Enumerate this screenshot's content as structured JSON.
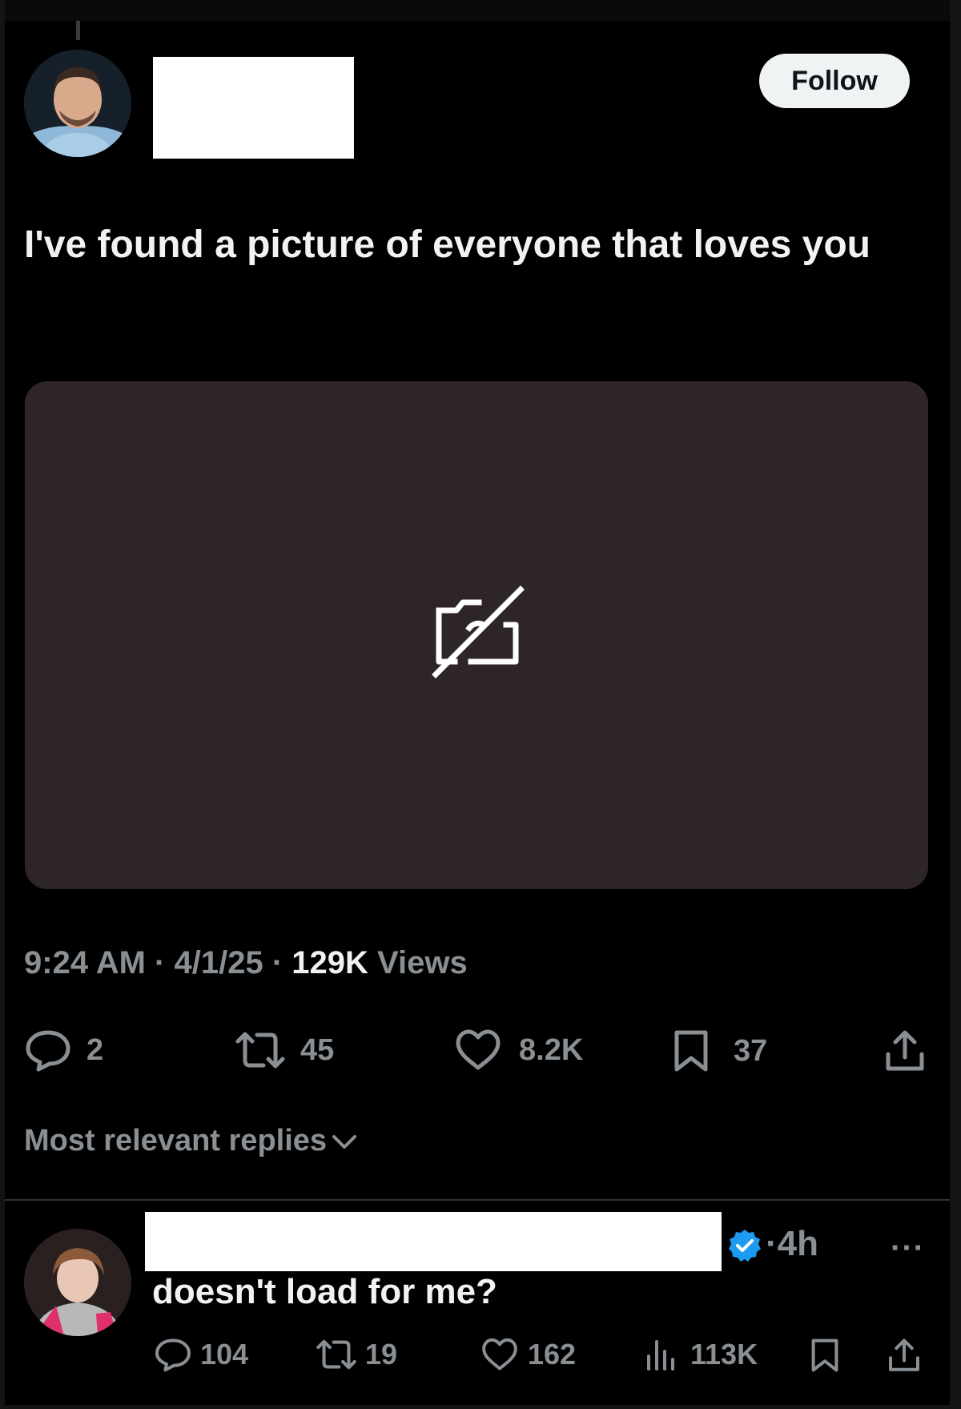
{
  "post": {
    "follow_label": "Follow",
    "text": "I've found a picture of everyone that loves you",
    "media_icon": "camera-off-icon",
    "time": "9:24 AM",
    "sep1": "·",
    "date": "4/1/25",
    "sep2": "·",
    "views_count": "129K",
    "views_label": "Views",
    "actions": {
      "replies": "2",
      "reposts": "45",
      "likes": "8.2K",
      "bookmarks": "37"
    }
  },
  "sort_label": "Most relevant replies",
  "reply": {
    "time": "·4h",
    "more": "···",
    "text": "doesn't load for me?",
    "actions": {
      "replies": "104",
      "reposts": "19",
      "likes": "162",
      "views": "113K"
    }
  },
  "colors": {
    "background": "#000000",
    "media_placeholder": "#2e2626",
    "muted_text": "#8a8f94",
    "verified_badge": "#1d9bf0"
  }
}
